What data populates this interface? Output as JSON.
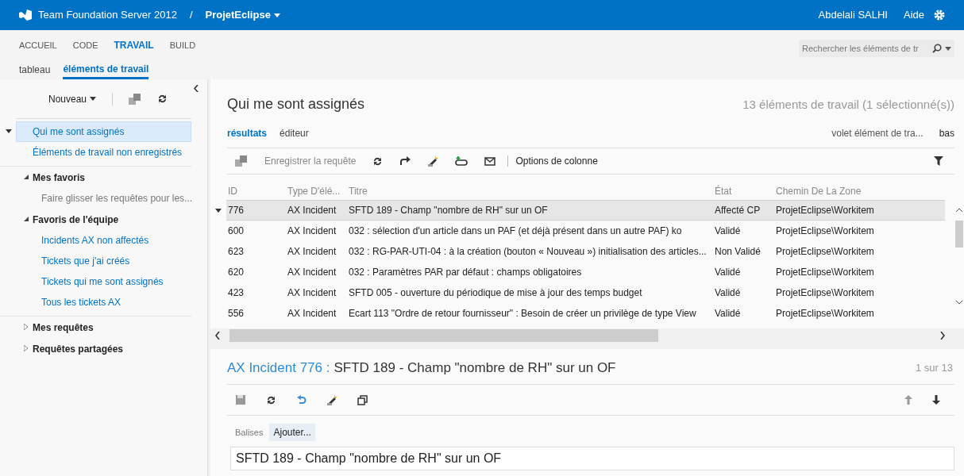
{
  "header": {
    "product": "Team Foundation Server 2012",
    "separator": "/",
    "project": "ProjetEclipse",
    "user": "Abdelali SALHI",
    "help": "Aide"
  },
  "nav": {
    "tabs": [
      {
        "label": "ACCUEIL",
        "selected": false
      },
      {
        "label": "CODE",
        "selected": false
      },
      {
        "label": "TRAVAIL",
        "selected": true
      },
      {
        "label": "BUILD",
        "selected": false
      }
    ],
    "subtabs": [
      {
        "label": "tableau",
        "selected": false
      },
      {
        "label": "éléments de travail",
        "selected": true
      }
    ],
    "search": {
      "placeholder": "Rechercher les éléments de tr"
    }
  },
  "sidebar": {
    "new_button": "Nouveau",
    "items": [
      {
        "label": "Qui me sont assignés",
        "selected": true
      },
      {
        "label": "Éléments de travail non enregistrés",
        "selected": false
      }
    ],
    "sections": [
      {
        "label": "Mes favoris",
        "expanded": true,
        "children": [
          {
            "label": "Faire glisser les requêtes pour les...",
            "kind": "hint"
          }
        ]
      },
      {
        "label": "Favoris de l'équipe",
        "expanded": true,
        "children": [
          {
            "label": "Incidents AX non affectés",
            "kind": "link"
          },
          {
            "label": "Tickets que j'ai créés",
            "kind": "link"
          },
          {
            "label": "Tickets qui me sont assignés",
            "kind": "link"
          },
          {
            "label": "Tous les tickets AX",
            "kind": "link"
          }
        ]
      },
      {
        "label": "Mes requêtes",
        "expanded": false
      },
      {
        "label": "Requêtes partagées",
        "expanded": false
      }
    ]
  },
  "query": {
    "title": "Qui me sont assignés",
    "count": "13 éléments de travail (1 sélectionné(s))",
    "view_tabs": [
      {
        "label": "résultats",
        "selected": true
      },
      {
        "label": "éditeur",
        "selected": false
      }
    ],
    "pane_label": "volet élément de tra...",
    "pane_value": "bas",
    "toolbar": {
      "save": "Enregistrer la requête",
      "column_options": "Options de colonne"
    },
    "table": {
      "columns": [
        "ID",
        "Type D'élé...",
        "Titre",
        "État",
        "Chemin De La Zone"
      ],
      "rows": [
        {
          "id": "776",
          "type": "AX Incident",
          "title": "SFTD 189 - Champ \"nombre de RH\" sur un OF",
          "state": "Affecté CP",
          "area": "ProjetEclipse\\Workitem",
          "selected": true
        },
        {
          "id": "600",
          "type": "AX Incident",
          "title": "032 : sélection d'un article dans un PAF (et déjà présent dans un autre PAF) ko",
          "state": "Validé",
          "area": "ProjetEclipse\\Workitem",
          "selected": false
        },
        {
          "id": "623",
          "type": "AX Incident",
          "title": "032 : RG-PAR-UTI-04 : à la création (bouton « Nouveau ») initialisation des articles...",
          "state": "Non Validé",
          "area": "ProjetEclipse\\Workitem",
          "selected": false
        },
        {
          "id": "620",
          "type": "AX Incident",
          "title": "032 : Paramètres PAR par défaut : champs obligatoires",
          "state": "Validé",
          "area": "ProjetEclipse\\Workitem",
          "selected": false
        },
        {
          "id": "423",
          "type": "AX Incident",
          "title": "SFTD 005 - ouverture du périodique de mise à jour des temps budget",
          "state": "Validé",
          "area": "ProjetEclipse\\Workitem",
          "selected": false
        },
        {
          "id": "556",
          "type": "AX Incident",
          "title": "Ecart 113 \"Ordre de retour fournisseur\" : Besoin de créer un privilège de type View",
          "state": "Validé",
          "area": "ProjetEclipse\\Workitem",
          "selected": false
        }
      ]
    }
  },
  "detail": {
    "type_link": "AX Incident 776 :",
    "title": "SFTD 189 - Champ \"nombre de RH\" sur un OF",
    "position": "1 sur 13",
    "tags_label": "Balises",
    "add_tag": "Ajouter...",
    "title_field": "SFTD 189 - Champ \"nombre de RH\" sur un OF"
  }
}
